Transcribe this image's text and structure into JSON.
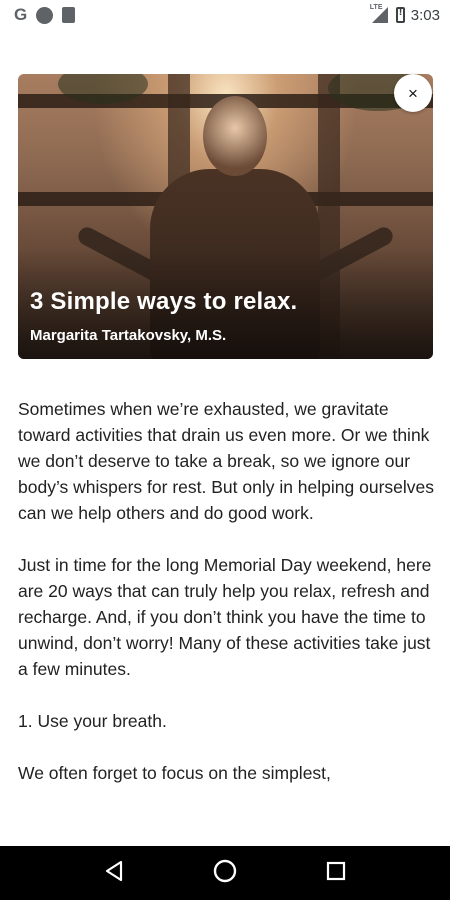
{
  "status_bar": {
    "time": "3:03",
    "left_icons": [
      "google-g-icon",
      "circle-notification-icon",
      "sd-card-icon"
    ],
    "google_letter": "G",
    "network_label": "LTE",
    "right_icons": [
      "signal-icon",
      "battery-alert-icon"
    ]
  },
  "hero": {
    "title": "3 Simple ways to relax.",
    "author": "Margarita Tartakovsky, M.S.",
    "close_label": "×"
  },
  "article": {
    "paragraphs": [
      "Sometimes when we’re exhausted, we gravitate toward activities that drain us even more. Or we think we don’t deserve to take a break, so we ignore our body’s whispers for rest. But only in helping ourselves can we help others and do good work.",
      "Just in time for the long Memorial Day weekend, here are 20 ways that can truly help you relax, refresh and recharge. And, if you don’t think you have the time to unwind, don’t worry! Many of these activities take just a few minutes.",
      "1. Use your breath.",
      "We often forget to focus on the simplest,"
    ]
  },
  "nav_bar": {
    "icons": [
      "back-icon",
      "home-icon",
      "recents-icon"
    ]
  },
  "colors": {
    "status_icon": "#5f6368",
    "text": "#222222",
    "nav_background": "#000000"
  }
}
